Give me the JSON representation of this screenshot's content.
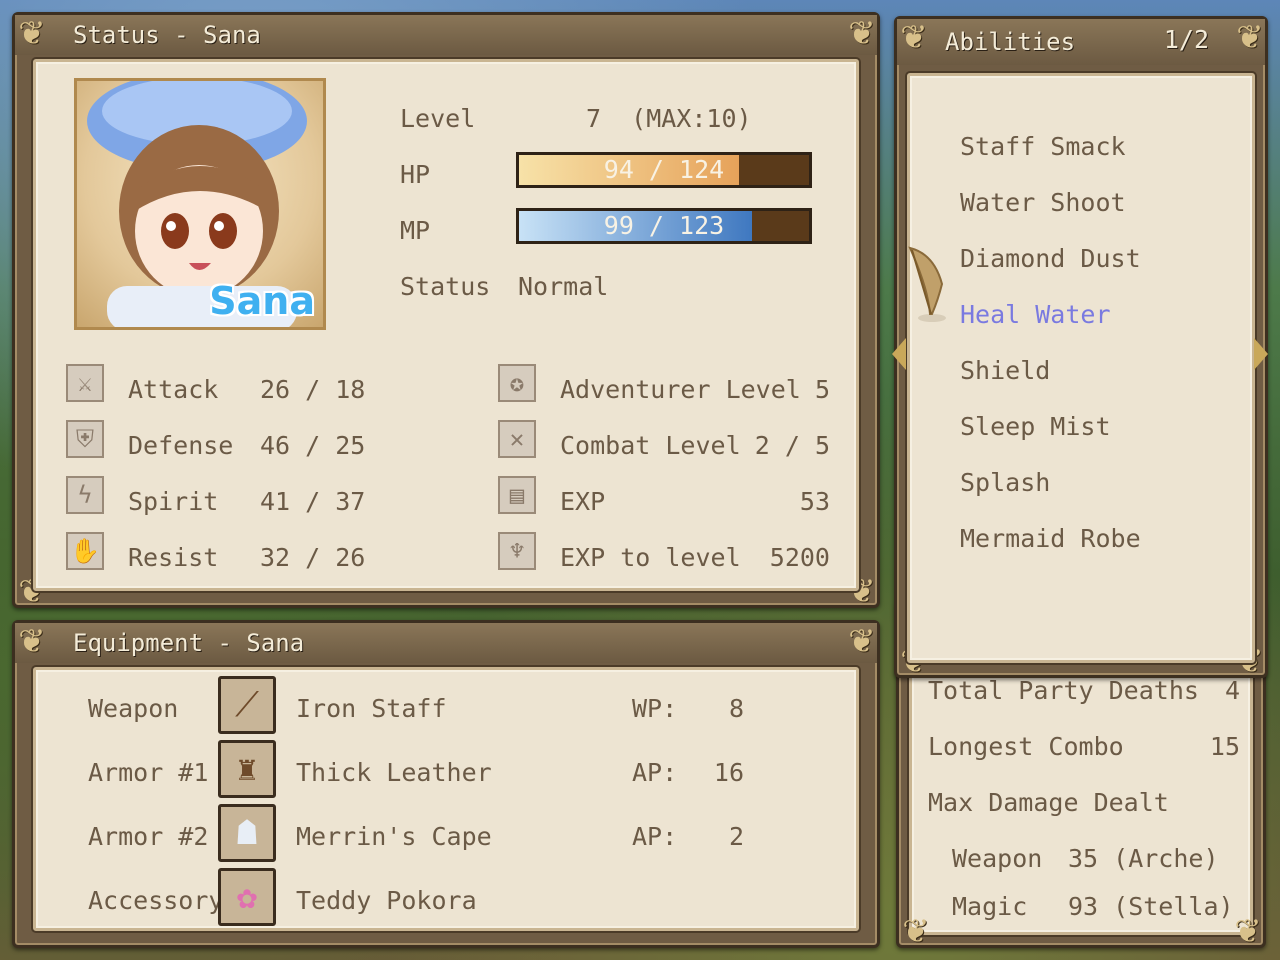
{
  "status": {
    "title": "Status - Sana",
    "portrait_name": "Sana",
    "level_label": "Level",
    "level_value": "7  (MAX:10)",
    "hp_label": "HP",
    "hp_text": "94 / 124",
    "hp_ratio": 0.7581,
    "mp_label": "MP",
    "mp_text": "99 / 123",
    "mp_ratio": 0.8049,
    "status_label": "Status",
    "status_value": "Normal",
    "stats": [
      {
        "label": "Attack",
        "value": "26 / 18",
        "icon": "sword-icon"
      },
      {
        "label": "Defense",
        "value": "46 / 25",
        "icon": "shield-icon"
      },
      {
        "label": "Spirit",
        "value": "41 / 37",
        "icon": "spirit-icon"
      },
      {
        "label": "Resist",
        "value": "32 / 26",
        "icon": "hand-icon"
      }
    ],
    "progress": [
      {
        "label": "Adventurer Level",
        "value": "5",
        "icon": "compass-icon"
      },
      {
        "label": "Combat Level",
        "value": "2 / 5",
        "icon": "crossed-swords-icon"
      },
      {
        "label": "EXP",
        "value": "53",
        "icon": "book-icon"
      },
      {
        "label": "EXP to level",
        "value": "5200",
        "icon": "chalice-icon"
      }
    ]
  },
  "abilities": {
    "title": "Abilities",
    "page": "1/2",
    "items": [
      "Staff Smack",
      "Water Shoot",
      "Diamond Dust",
      "Heal Water",
      "Shield",
      "Sleep Mist",
      "Splash",
      "Mermaid Robe"
    ],
    "selected_index": 3,
    "selected_color": "#7a7ae0"
  },
  "equipment": {
    "title": "Equipment - Sana",
    "slots": [
      {
        "slot": "Weapon",
        "item": "Iron Staff",
        "stat": "WP:",
        "value": "8",
        "icon": "staff-icon"
      },
      {
        "slot": "Armor #1",
        "item": "Thick Leather",
        "stat": "AP:",
        "value": "16",
        "icon": "leather-armor-icon"
      },
      {
        "slot": "Armor #2",
        "item": "Merrin's Cape",
        "stat": "AP:",
        "value": "2",
        "icon": "cape-icon"
      },
      {
        "slot": "Accessory",
        "item": "Teddy Pokora",
        "stat": "",
        "value": "",
        "icon": "bunny-icon"
      }
    ]
  },
  "records": {
    "party_deaths_label": "Total Party Deaths",
    "party_deaths_value": "4",
    "combo_label": "Longest Combo",
    "combo_value": "15",
    "max_damage_label": "Max Damage Dealt",
    "weapon_label": "Weapon",
    "weapon_value": "35 (Arche)",
    "magic_label": "Magic",
    "magic_value": "93 (Stella)"
  },
  "colors": {
    "hp_fill": "#e7a860",
    "mp_fill": "#4f86c6",
    "text": "#6b5a46"
  }
}
